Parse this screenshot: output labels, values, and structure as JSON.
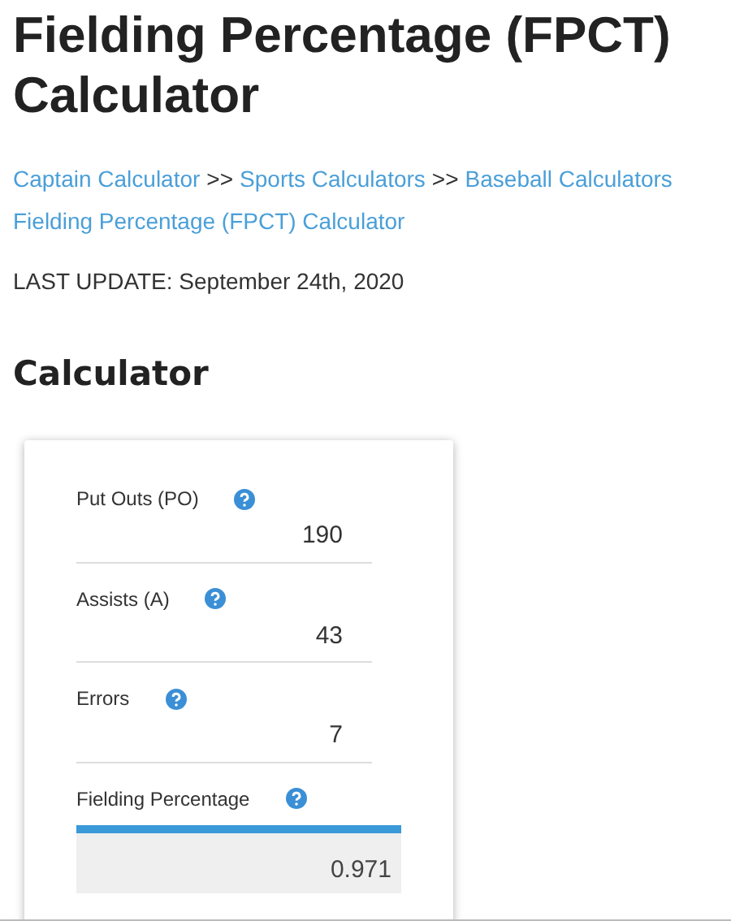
{
  "title": "Fielding Percentage (FPCT) Calculator",
  "breadcrumb": [
    {
      "text": "Captain Calculator",
      "kind": "link"
    },
    {
      "text": ">>",
      "kind": "separator"
    },
    {
      "text": "Sports Calculators",
      "kind": "link"
    },
    {
      "text": ">>",
      "kind": "separator"
    },
    {
      "text": "Baseball Calculators",
      "kind": "link"
    },
    {
      "text": "Fielding Percentage (FPCT) Calculator",
      "kind": "link"
    }
  ],
  "last_update": "LAST UPDATE: September 24th, 2020",
  "section_heading": "Calculator",
  "fields": [
    {
      "label": "Put Outs (PO)",
      "value": "190",
      "kind": "input"
    },
    {
      "label": "Assists (A)",
      "value": "43",
      "kind": "input"
    },
    {
      "label": "Errors",
      "value": "7",
      "kind": "input"
    },
    {
      "label": "Fielding Percentage",
      "value": "0.971",
      "kind": "result"
    }
  ]
}
